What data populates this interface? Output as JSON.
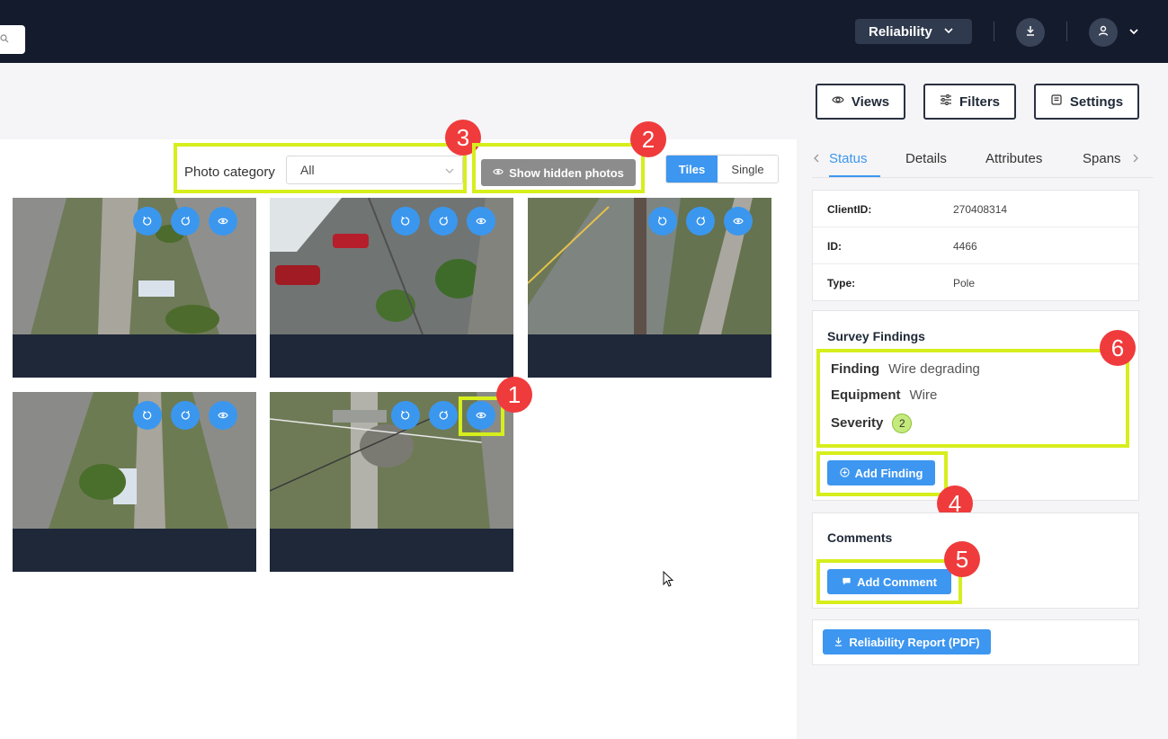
{
  "header": {
    "org_select": "Reliability",
    "icons": {
      "search": "search-icon",
      "download": "download-icon",
      "user": "user-icon"
    }
  },
  "toolbar": {
    "views_label": "Views",
    "filters_label": "Filters",
    "settings_label": "Settings"
  },
  "photos": {
    "category_label": "Photo category",
    "category_value": "All",
    "show_hidden_label": "Show hidden photos",
    "view_modes": [
      "Tiles",
      "Single"
    ],
    "active_view_mode": "Tiles",
    "tile_count": 5,
    "tile_actions": [
      "rotate-left-icon",
      "rotate-right-icon",
      "eye-icon"
    ]
  },
  "callouts": [
    "1",
    "2",
    "3",
    "4",
    "5",
    "6"
  ],
  "panel": {
    "tabs": [
      "Status",
      "Details",
      "Attributes",
      "Spans"
    ],
    "active_tab": "Status",
    "info": [
      {
        "key": "ClientID:",
        "value": "270408314"
      },
      {
        "key": "ID:",
        "value": "4466"
      },
      {
        "key": "Type:",
        "value": "Pole"
      }
    ],
    "survey": {
      "title": "Survey Findings",
      "finding_label": "Finding",
      "finding_value": "Wire degrading",
      "equipment_label": "Equipment",
      "equipment_value": "Wire",
      "severity_label": "Severity",
      "severity_value": "2",
      "add_finding_label": "Add Finding"
    },
    "comments": {
      "title": "Comments",
      "add_comment_label": "Add Comment"
    },
    "report_label": "Reliability Report (PDF)"
  },
  "colors": {
    "topbar": "#141b2d",
    "accent": "#3d97f0",
    "highlight": "#d6ee1b",
    "callout": "#ef3b3b",
    "severity": "#c3ea7a"
  }
}
